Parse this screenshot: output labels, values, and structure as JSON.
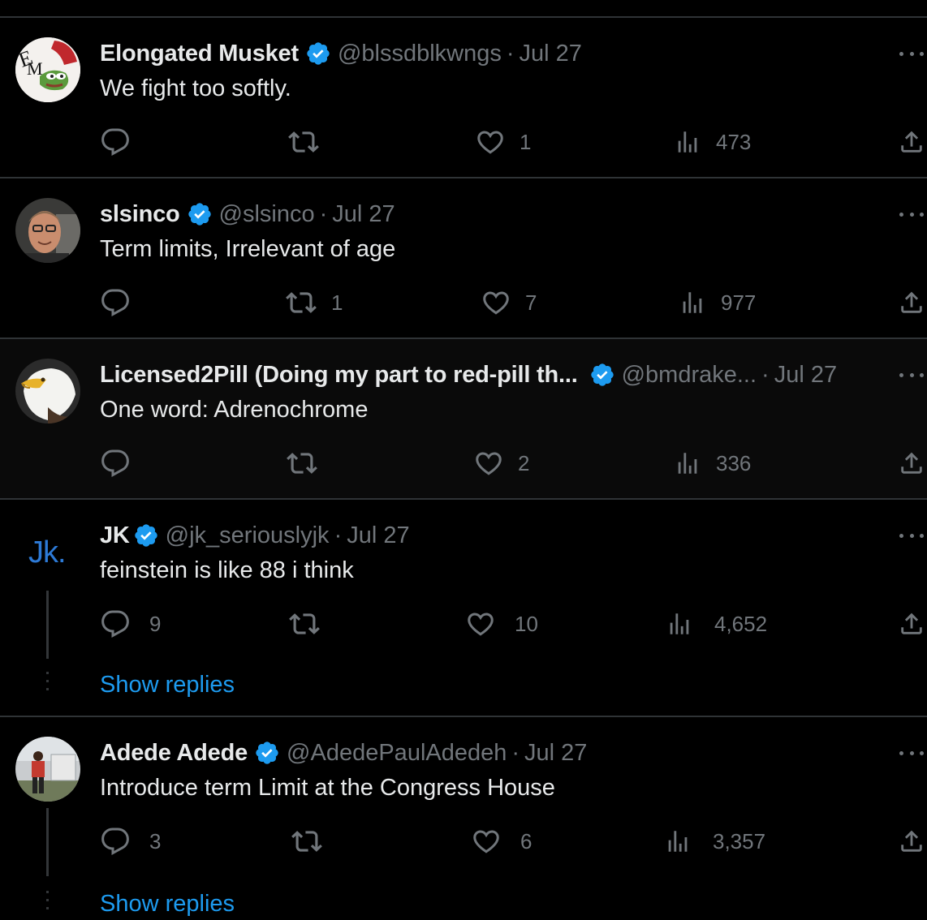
{
  "colors": {
    "background": "#000000",
    "text": "#e7e9ea",
    "muted": "#71767b",
    "accent": "#1d9bf0",
    "divider": "#2f3336"
  },
  "icons": {
    "reply": "reply-icon",
    "retweet": "retweet-icon",
    "like": "heart-icon",
    "views": "views-icon",
    "share": "share-icon",
    "verified": "verified-badge-icon",
    "more": "more-options-icon"
  },
  "tweets": [
    {
      "name": "Elongated Musket",
      "handle": "@blssdblkwngs",
      "date": "Jul 27",
      "text": "We fight too softly.",
      "replies": "",
      "retweets": "",
      "likes": "1",
      "views": "473"
    },
    {
      "name": "slsinco",
      "handle": "@slsinco",
      "date": "Jul 27",
      "text": "Term limits, Irrelevant of age",
      "replies": "",
      "retweets": "1",
      "likes": "7",
      "views": "977"
    },
    {
      "name": "Licensed2Pill (Doing my part to red-pill th...",
      "handle": "@bmdrake...",
      "date": "Jul 27",
      "text": "One word: Adrenochrome",
      "replies": "",
      "retweets": "",
      "likes": "2",
      "views": "336"
    },
    {
      "name": "JK",
      "handle": "@jk_seriouslyjk",
      "date": "Jul 27",
      "text": "feinstein is like 88 i think",
      "replies": "9",
      "retweets": "",
      "likes": "10",
      "views": "4,652",
      "show_replies": "Show replies",
      "avatar_text": "Jk."
    },
    {
      "name": "Adede Adede",
      "handle": "@AdedePaulAdedeh",
      "date": "Jul 27",
      "text": "Introduce term Limit at the Congress House",
      "replies": "3",
      "retweets": "",
      "likes": "6",
      "views": "3,357",
      "show_replies": "Show replies"
    }
  ]
}
